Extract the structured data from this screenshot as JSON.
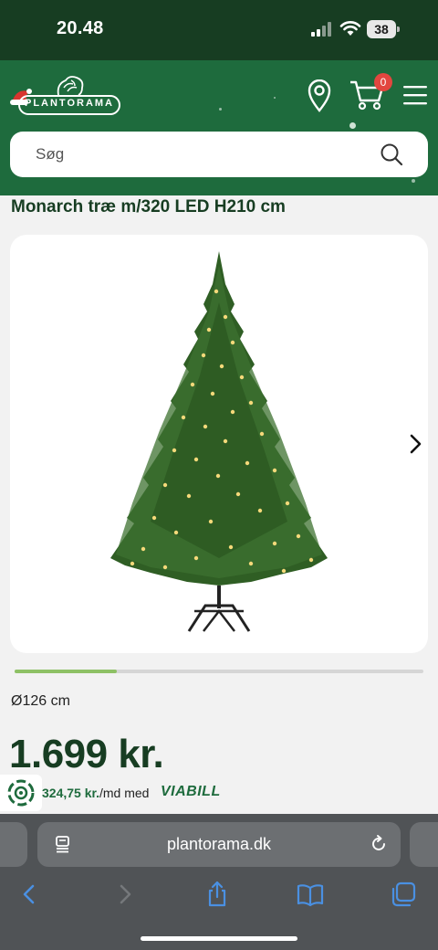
{
  "status_bar": {
    "time": "20.48",
    "battery": "38"
  },
  "header": {
    "logo_text": "PLANTORAMA",
    "cart_count": "0"
  },
  "search": {
    "placeholder": "Søg"
  },
  "product": {
    "title": "Monarch træ m/320 LED H210 cm",
    "diameter": "Ø126 cm",
    "price": "1.699 kr.",
    "image_progress": 0.25
  },
  "financing": {
    "amount": "324,75 kr.",
    "text": "/md med",
    "brand": "VIABILL"
  },
  "browser": {
    "url": "plantorama.dk"
  },
  "colors": {
    "header_green": "#1e6b3d",
    "status_green": "#173d22",
    "accent_light_green": "#8ec165",
    "badge_red": "#e2463f",
    "browser_gray": "#505356",
    "ios_blue": "#4a90e2"
  }
}
